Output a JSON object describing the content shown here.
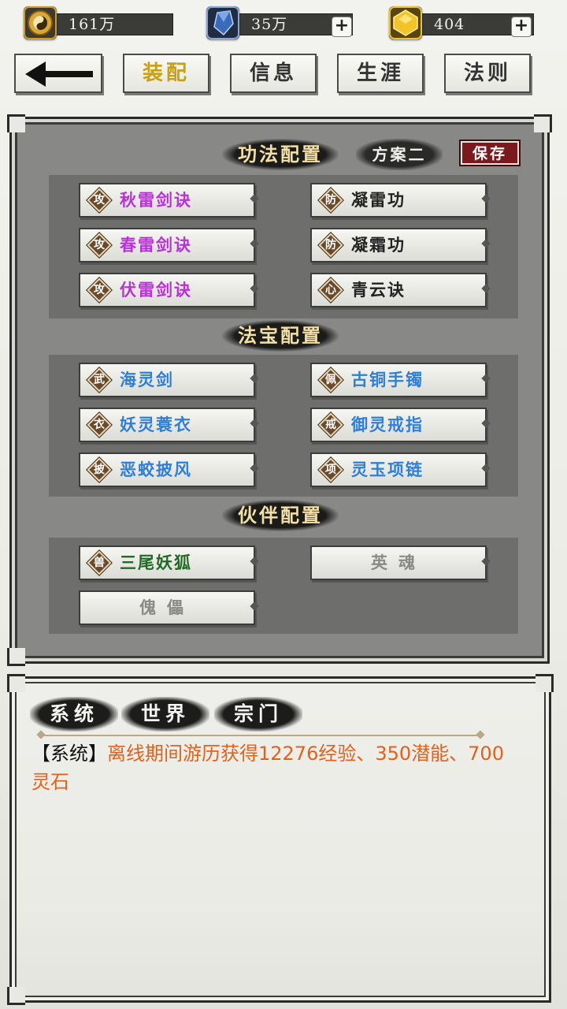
{
  "resources": [
    {
      "icon": "taiji-coin-icon",
      "value": "161万",
      "has_plus": false
    },
    {
      "icon": "blue-crystal-icon",
      "value": "35万",
      "has_plus": true
    },
    {
      "icon": "gold-gem-icon",
      "value": "404",
      "has_plus": true
    }
  ],
  "nav": {
    "back_icon": "back-arrow-icon",
    "tabs": [
      "装配",
      "信息",
      "生涯",
      "法则"
    ],
    "active": "装配"
  },
  "config": {
    "skills_title": "功法配置",
    "plan_label": "方案二",
    "save_label": "保存",
    "skills": [
      {
        "badge": "攻",
        "name": "秋雷剑诀",
        "color": "#b832d6"
      },
      {
        "badge": "防",
        "name": "凝雷功",
        "color": "#222222"
      },
      {
        "badge": "攻",
        "name": "春雷剑诀",
        "color": "#b832d6"
      },
      {
        "badge": "防",
        "name": "凝霜功",
        "color": "#222222"
      },
      {
        "badge": "攻",
        "name": "伏雷剑诀",
        "color": "#b832d6"
      },
      {
        "badge": "心",
        "name": "青云诀",
        "color": "#222222"
      }
    ],
    "treasures_title": "法宝配置",
    "treasures": [
      {
        "badge": "武",
        "name": "海灵剑",
        "color": "#2f7fd6"
      },
      {
        "badge": "佩",
        "name": "古铜手镯",
        "color": "#2f7fd6"
      },
      {
        "badge": "衣",
        "name": "妖灵蓑衣",
        "color": "#2f7fd6"
      },
      {
        "badge": "戒",
        "name": "御灵戒指",
        "color": "#2f7fd6"
      },
      {
        "badge": "披",
        "name": "恶蛟披风",
        "color": "#2f7fd6"
      },
      {
        "badge": "项",
        "name": "灵玉项链",
        "color": "#2f7fd6"
      }
    ],
    "partners_title": "伙伴配置",
    "partners": [
      {
        "badge": "兽",
        "name": "三尾妖狐",
        "color": "#1f6b22"
      },
      {
        "empty": "英魂"
      },
      {
        "empty": "傀儡"
      }
    ]
  },
  "chat": {
    "tabs": [
      "系统",
      "世界",
      "宗门"
    ],
    "message_tag": "【系统】",
    "message_text": "离线期间游历获得12276经验、350潜能、700灵石"
  }
}
